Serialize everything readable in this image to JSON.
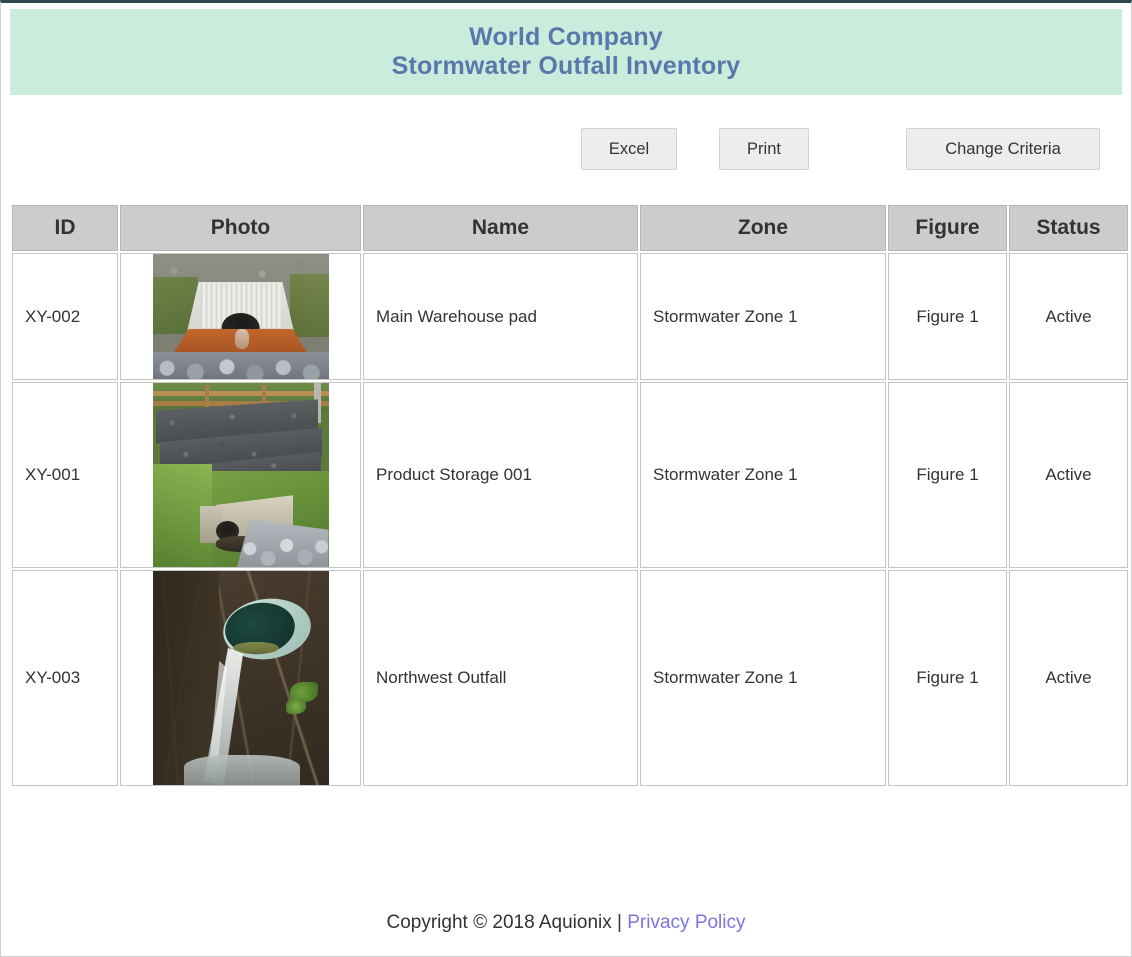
{
  "banner": {
    "company": "World Company",
    "subtitle": "Stormwater Outfall Inventory",
    "background_color": "#c9ecdc",
    "text_color": "#5878ac"
  },
  "toolbar": {
    "excel_label": "Excel",
    "print_label": "Print",
    "change_criteria_label": "Change Criteria"
  },
  "table": {
    "columns": [
      "ID",
      "Photo",
      "Name",
      "Zone",
      "Figure",
      "Status"
    ],
    "rows": [
      {
        "id": "XY-002",
        "photo_alt": "box-culvert-outfall-photo",
        "name": "Main Warehouse pad",
        "zone": "Stormwater Zone 1",
        "figure": "Figure 1",
        "status": "Active"
      },
      {
        "id": "XY-001",
        "photo_alt": "gabion-wall-headwall-outfall-photo",
        "name": "Product Storage 001",
        "zone": "Stormwater Zone 1",
        "figure": "Figure 1",
        "status": "Active"
      },
      {
        "id": "XY-003",
        "photo_alt": "discharging-pipe-outfall-photo",
        "name": "Northwest Outfall",
        "zone": "Stormwater Zone 1",
        "figure": "Figure 1",
        "status": "Active"
      }
    ]
  },
  "footer": {
    "copyright": "Copyright © 2018 Aquionix | ",
    "privacy_link": "Privacy Policy",
    "link_color": "#7b73df"
  }
}
